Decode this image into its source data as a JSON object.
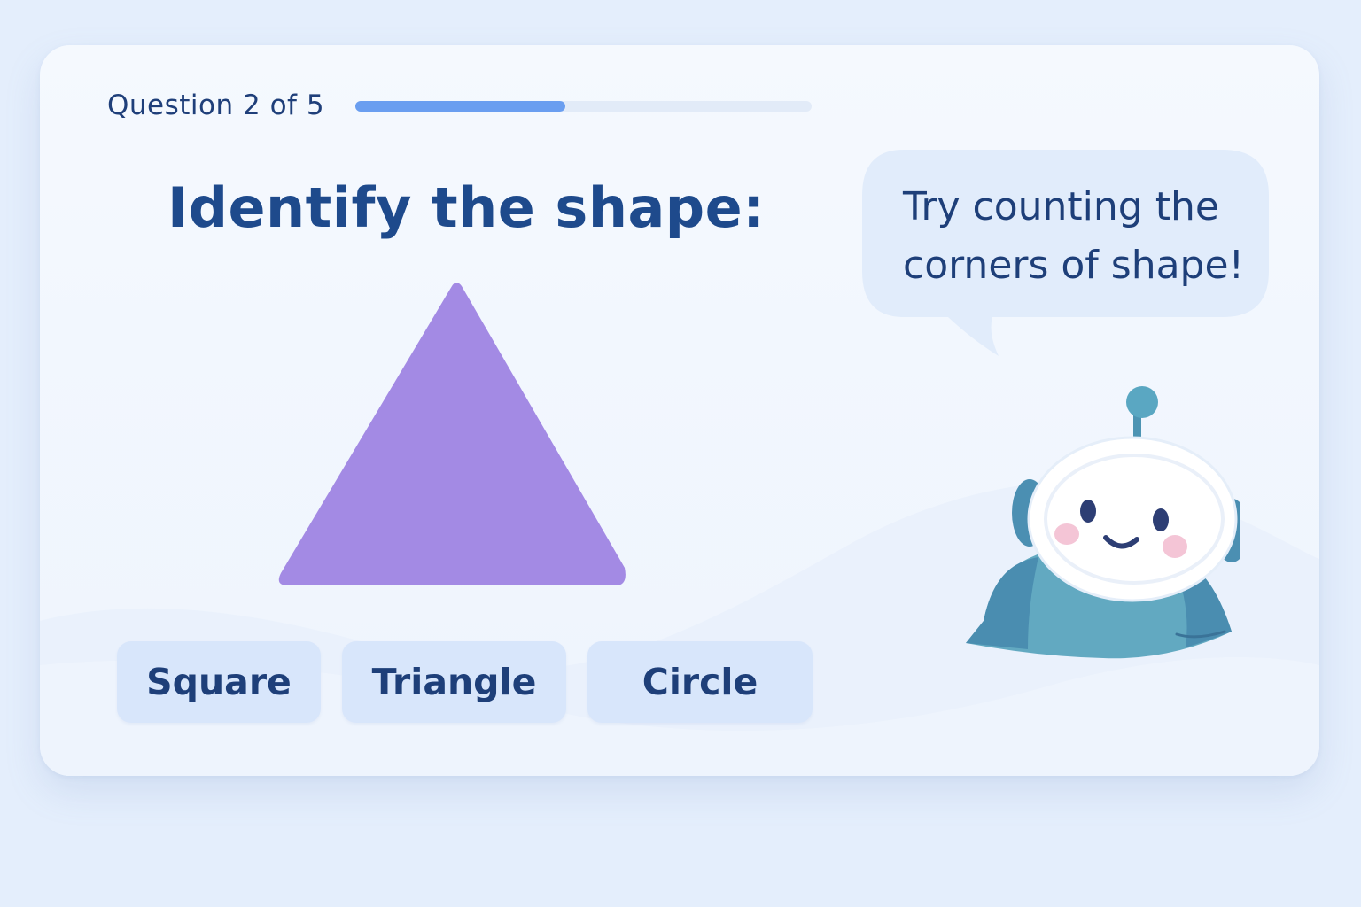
{
  "quiz": {
    "progress_label": "Question 2 of 5",
    "current": 2,
    "total": 5,
    "progress_fraction": 0.46,
    "question": "Identify the shape:",
    "shape": "triangle",
    "shape_color": "#a38ae4",
    "options": [
      {
        "label": "Square"
      },
      {
        "label": "Triangle"
      },
      {
        "label": "Circle"
      }
    ]
  },
  "assistant": {
    "hint": "Try counting the corners of shape!",
    "avatar": "robot-mascot"
  },
  "colors": {
    "background": "#e4eefc",
    "card": "#f3f8fe",
    "accent": "#6a9ef0",
    "title": "#1e4a8c",
    "option_bg": "#d8e6fb",
    "bubble": "#e1ecfb"
  }
}
